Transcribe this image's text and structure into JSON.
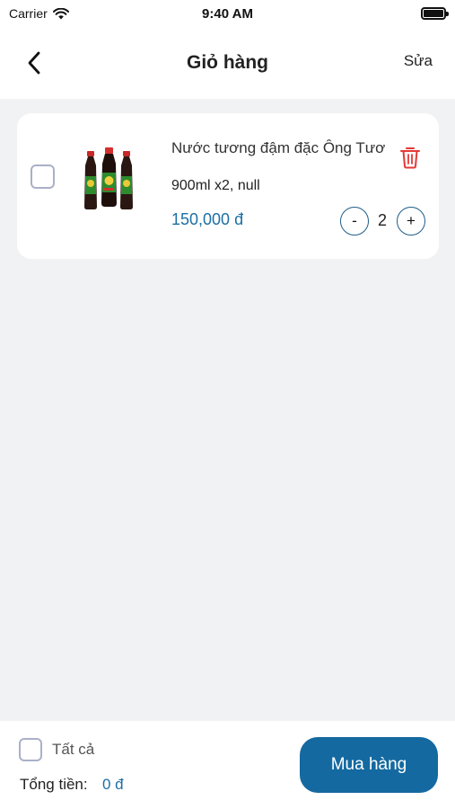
{
  "status_bar": {
    "carrier": "Carrier",
    "time": "9:40 AM"
  },
  "header": {
    "title": "Giỏ hàng",
    "edit_label": "Sửa",
    "back_icon": "chevron-left-icon"
  },
  "cart": {
    "items": [
      {
        "name": "Nước tương đậm đặc Ông Tươ",
        "variant": "900ml x2, null",
        "price": "150,000 đ",
        "quantity": "2",
        "minus_label": "-",
        "plus_label": "+",
        "checked": false,
        "image": "soy-sauce-bottles"
      }
    ]
  },
  "footer": {
    "select_all_label": "Tất cả",
    "total_label": "Tổng tiền:",
    "total_value": "0 đ",
    "buy_label": "Mua hàng"
  },
  "colors": {
    "accent": "#1469a0",
    "price": "#1c6fa3",
    "delete": "#e53935",
    "background": "#f1f2f4"
  }
}
